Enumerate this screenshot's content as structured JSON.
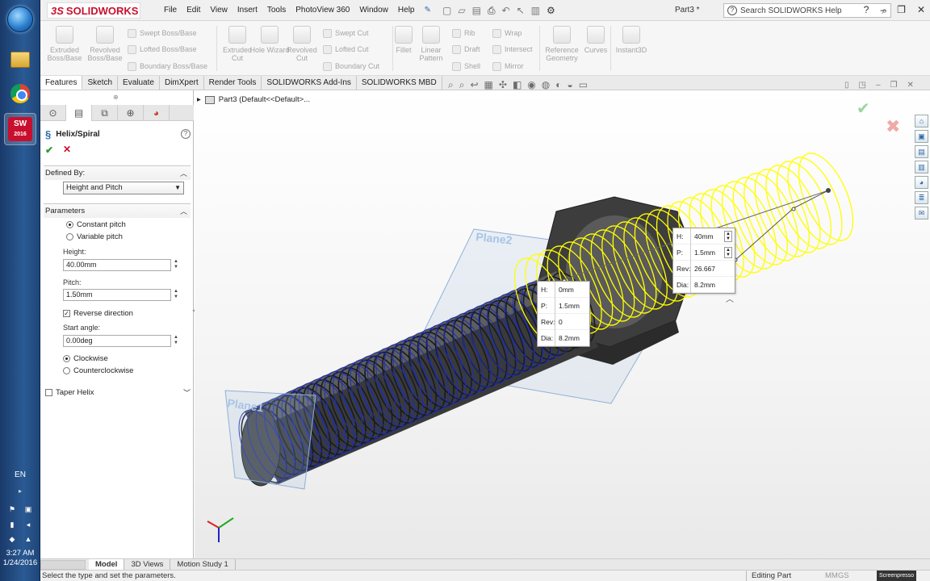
{
  "taskbar": {
    "language": "EN",
    "time": "3:27 AM",
    "date": "1/24/2016",
    "sw_badge_top": "SW",
    "sw_badge_year": "2016"
  },
  "titlebar": {
    "brand_prefix": "3S",
    "brand": "SOLIDWORKS",
    "menu": [
      "File",
      "Edit",
      "View",
      "Insert",
      "Tools",
      "PhotoView 360",
      "Window",
      "Help"
    ],
    "document": "Part3 *",
    "search_placeholder": "Search SOLIDWORKS Help"
  },
  "ribbon": {
    "extruded_boss": "Extruded Boss/Base",
    "revolved_boss": "Revolved Boss/Base",
    "swept_boss": "Swept Boss/Base",
    "lofted_boss": "Lofted Boss/Base",
    "boundary_boss": "Boundary Boss/Base",
    "extruded_cut": "Extruded Cut",
    "hole_wizard": "Hole Wizard",
    "revolved_cut": "Revolved Cut",
    "swept_cut": "Swept Cut",
    "lofted_cut": "Lofted Cut",
    "boundary_cut": "Boundary Cut",
    "fillet": "Fillet",
    "linear_pattern": "Linear Pattern",
    "rib": "Rib",
    "draft": "Draft",
    "shell": "Shell",
    "wrap": "Wrap",
    "intersect": "Intersect",
    "mirror": "Mirror",
    "reference_geometry": "Reference Geometry",
    "curves": "Curves",
    "instant3d": "Instant3D"
  },
  "tabs": [
    "Features",
    "Sketch",
    "Evaluate",
    "DimXpert",
    "Render Tools",
    "SOLIDWORKS Add-Ins",
    "SOLIDWORKS MBD"
  ],
  "panel": {
    "title": "Helix/Spiral",
    "defined_by": {
      "header": "Defined By:",
      "value": "Height and Pitch"
    },
    "parameters": {
      "header": "Parameters",
      "constant_pitch": "Constant pitch",
      "variable_pitch": "Variable pitch",
      "height_label": "Height:",
      "height_value": "40.00mm",
      "pitch_label": "Pitch:",
      "pitch_value": "1.50mm",
      "reverse_direction": "Reverse direction",
      "start_angle_label": "Start angle:",
      "start_angle_value": "0.00deg",
      "clockwise": "Clockwise",
      "counterclockwise": "Counterclockwise"
    },
    "taper_helix": "Taper Helix"
  },
  "viewport": {
    "tree_item": "Part3  (Default<<Default>...",
    "plane1": "Plane1",
    "plane2": "Plane2",
    "callout_start": {
      "h_label": "H:",
      "h": "0mm",
      "p_label": "P:",
      "p": "1.5mm",
      "rev_label": "Rev:",
      "rev": "0",
      "dia_label": "Dia:",
      "dia": "8.2mm"
    },
    "callout_end": {
      "h_label": "H:",
      "h": "40mm",
      "p_label": "P:",
      "p": "1.5mm",
      "rev_label": "Rev:",
      "rev": "26.667",
      "dia_label": "Dia:",
      "dia": "8.2mm"
    }
  },
  "bottom_tabs": [
    "Model",
    "3D Views",
    "Motion Study 1"
  ],
  "status": {
    "message": "Select the type and set the parameters.",
    "mode": "Editing Part",
    "units": "MMGS",
    "watermark": "Screenpresso"
  },
  "colors": {
    "brand": "#c8102e",
    "helix_active": "#ffff00",
    "thread_blue": "#1c2fb0",
    "ok_green": "#2e9a2e"
  }
}
